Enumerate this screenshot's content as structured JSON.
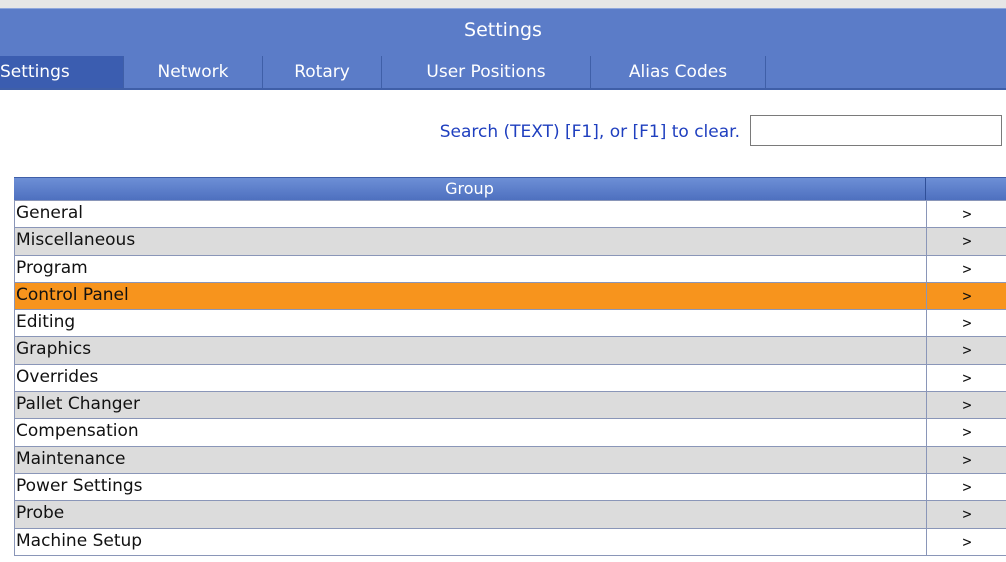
{
  "window": {
    "title": "Settings"
  },
  "tabs": [
    {
      "label": "Settings",
      "active": true
    },
    {
      "label": "Network",
      "active": false
    },
    {
      "label": "Rotary",
      "active": false
    },
    {
      "label": "User Positions",
      "active": false
    },
    {
      "label": "Alias Codes",
      "active": false
    }
  ],
  "search": {
    "label": "Search (TEXT) [F1], or [F1] to clear.",
    "value": ""
  },
  "table": {
    "header": "Group",
    "arrow_glyph": ">",
    "selected_index": 3,
    "rows": [
      "General",
      "Miscellaneous",
      "Program",
      "Control Panel",
      "Editing",
      "Graphics",
      "Overrides",
      "Pallet Changer",
      "Compensation",
      "Maintenance",
      "Power Settings",
      "Probe",
      "Machine Setup"
    ]
  },
  "colors": {
    "title_bar": "#5b7cc8",
    "selected_row": "#f7941d",
    "alt_row": "#dcdcdc",
    "search_label": "#1f3fbf"
  }
}
